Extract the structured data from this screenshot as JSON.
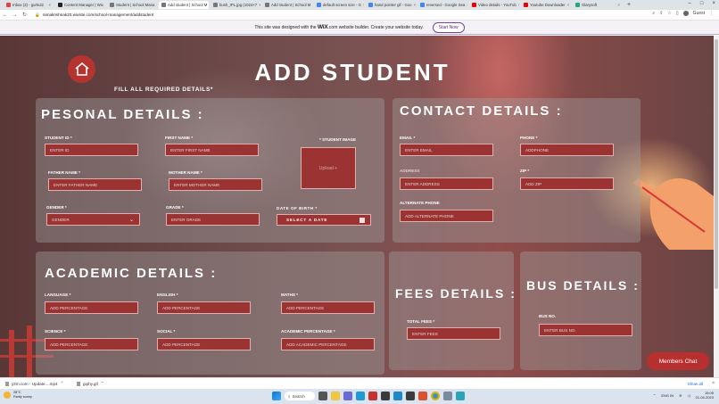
{
  "browser": {
    "tabs": [
      {
        "label": "Inbox (3) - gurkul2",
        "active": false
      },
      {
        "label": "Content Manager | Wix",
        "active": false
      },
      {
        "label": "Student | School Mana",
        "active": false
      },
      {
        "label": "Add student | School M",
        "active": true
      },
      {
        "label": "bush_IPL.jpg (1024×7",
        "active": false
      },
      {
        "label": "Add student | School M",
        "active": false
      },
      {
        "label": "default screen size - G",
        "active": false
      },
      {
        "label": "hand pointer gif - Goo",
        "active": false
      },
      {
        "label": "reversed - Google Sea",
        "active": false
      },
      {
        "label": "Video details - YouTub",
        "active": false
      },
      {
        "label": "Youtube Downloader",
        "active": false
      },
      {
        "label": "Glarysoft",
        "active": false
      }
    ],
    "new_tab": "+",
    "url": "ramakrishnak20.wixsite.com/school-management/addstudent",
    "guest_label": "Guest"
  },
  "wix_banner": {
    "text_before": "This site was designed with the",
    "brand": "WiX",
    "text_after": ".com website builder. Create your website today.",
    "cta": "Start Now"
  },
  "page": {
    "title": "ADD STUDENT",
    "subtitle": "FILL ALL REQUIRED DETAILS*",
    "personal": {
      "heading": "PESONAL DETAILS :",
      "student_id": {
        "label": "STUDENT ID *",
        "placeholder": "ENTER ID"
      },
      "first_name": {
        "label": "FIRST NAME *",
        "placeholder": "ENTER FIRST NAME"
      },
      "student_image": {
        "label": "* STUDENT IMAGE",
        "hint": "Upload +"
      },
      "father_name": {
        "label": "FATHER NAME *",
        "placeholder": "ENTER FATHER NAME"
      },
      "mother_name": {
        "label": "MOTHER NAME *",
        "placeholder": "ENTER MOTHER NAME"
      },
      "gender": {
        "label": "GENDER *",
        "placeholder": "GENDER"
      },
      "grade": {
        "label": "GRADE *",
        "placeholder": "ENTER GRADE"
      },
      "dob": {
        "label": "DATE OF BIRTH *",
        "placeholder": "SELECT A DATE"
      }
    },
    "contact": {
      "heading": "CONTACT DETAILS :",
      "email": {
        "label": "EMAIL *",
        "placeholder": "ENTER EMAIL"
      },
      "phone": {
        "label": "PHONE *",
        "placeholder": "ADDPHONE"
      },
      "address": {
        "label": "ADDRESS",
        "placeholder": "ENTER ADDRESS"
      },
      "zip": {
        "label": "ZIP *",
        "placeholder": "ADD ZIP"
      },
      "alt_phone": {
        "label": "ALTERNATE PHONE",
        "placeholder": "ADD ALTERNATE PHONE"
      }
    },
    "academic": {
      "heading": "ACADEMIC DETAILS :",
      "language": {
        "label": "LANGUAGE *",
        "placeholder": "ADD PERCENTAGE"
      },
      "english": {
        "label": "ENGLISH *",
        "placeholder": "ADD PERCENTAGE"
      },
      "maths": {
        "label": "MATHS *",
        "placeholder": "ADD PERCENTAGE"
      },
      "science": {
        "label": "SCIENCE *",
        "placeholder": "ADD PERCENTAGE"
      },
      "social": {
        "label": "SOCIAL *",
        "placeholder": "ADD PERCENTAGE"
      },
      "academic_pct": {
        "label": "ACADEMIC PERCENTAGE *",
        "placeholder": "ADD ACADEMIC PERCENTAGE"
      }
    },
    "fees": {
      "heading": "FEES DETAILS :",
      "total_fees": {
        "label": "TOTAL FEES *",
        "placeholder": "ENTER FEES"
      }
    },
    "bus": {
      "heading": "BUS DETAILS :",
      "bus_no": {
        "label": "BUS NO.",
        "placeholder": "ENTER BUS NO."
      }
    },
    "members_chat": "Members Chat"
  },
  "downloads": {
    "items": [
      "y2m.com - Update....mp4",
      "giphy.gif"
    ],
    "show_all": "Show all"
  },
  "taskbar": {
    "weather_temp": "28°C",
    "weather_desc": "Partly sunny",
    "search": "Search",
    "lang": "ENG IN",
    "time": "15:05",
    "date": "21-04-2023"
  },
  "colors": {
    "accent": "#b5342f",
    "input_bg": "#9b3333",
    "panel": "#a0a0a0",
    "wix_purple": "#5b2a86"
  }
}
